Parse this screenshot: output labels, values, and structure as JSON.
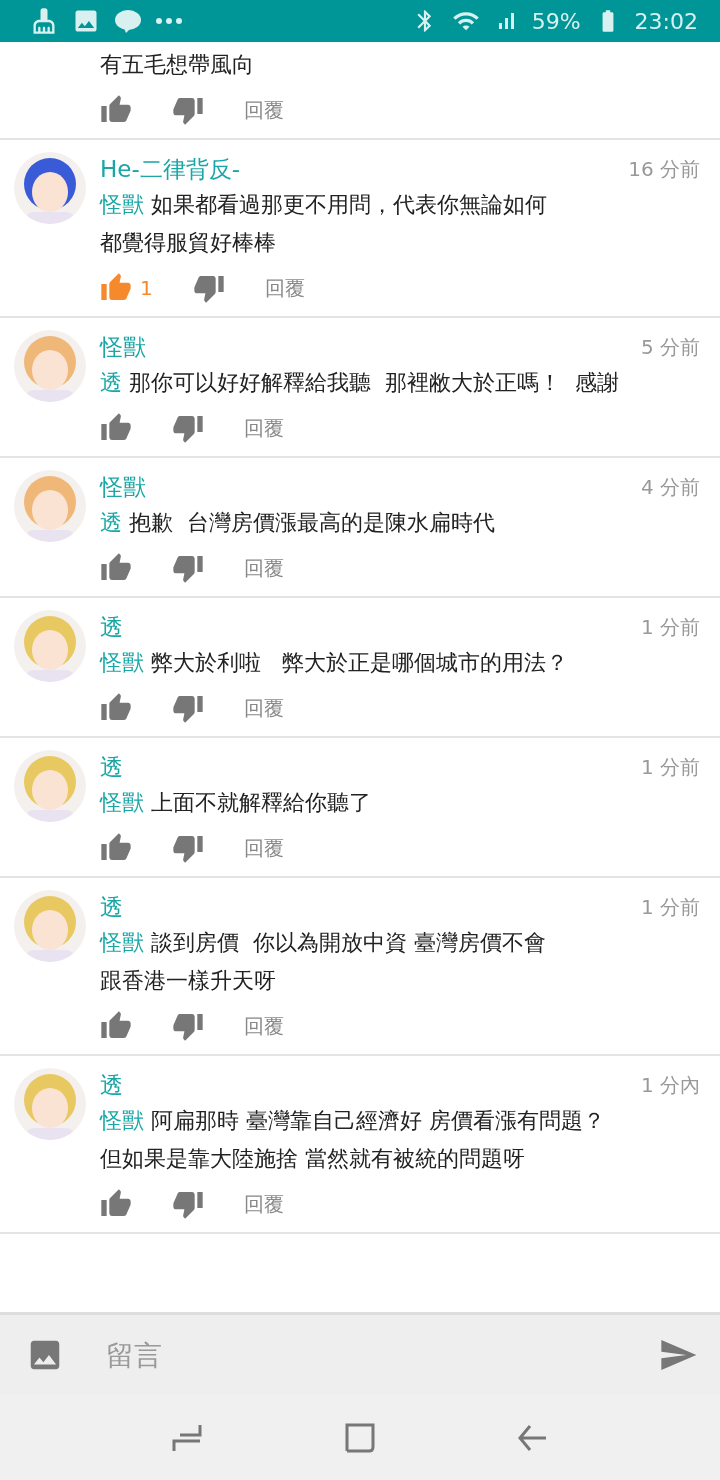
{
  "status_bar": {
    "battery": "59%",
    "time": "23:02"
  },
  "comments": [
    {
      "lines": [
        "有五毛想帶風向"
      ],
      "liked": false,
      "reply": "回覆"
    },
    {
      "name": "He-二律背反-",
      "time": "16 分前",
      "color": "#3a5bd8",
      "reply_to": "怪獸",
      "lines": [
        "如果都看過那更不用問，代表你無論如何",
        "都覺得服貿好棒棒"
      ],
      "liked": true,
      "likes": "1",
      "reply": "回覆"
    },
    {
      "name": "怪獸",
      "time": "5 分前",
      "color": "#f0b878",
      "reply_to": "透",
      "lines": [
        "那你可以好好解釋給我聽  那裡敝大於正嗎！  感謝"
      ],
      "liked": false,
      "reply": "回覆"
    },
    {
      "name": "怪獸",
      "time": "4 分前",
      "color": "#f0b878",
      "reply_to": "透",
      "lines": [
        "抱歉  台灣房價漲最高的是陳水扁時代"
      ],
      "liked": false,
      "reply": "回覆"
    },
    {
      "name": "透",
      "time": "1 分前",
      "color": "#e8c860",
      "reply_to": "怪獸",
      "lines": [
        "弊大於利啦   弊大於正是哪個城市的用法？"
      ],
      "liked": false,
      "reply": "回覆"
    },
    {
      "name": "透",
      "time": "1 分前",
      "color": "#e8c860",
      "reply_to": "怪獸",
      "lines": [
        "上面不就解釋給你聽了"
      ],
      "liked": false,
      "reply": "回覆"
    },
    {
      "name": "透",
      "time": "1 分前",
      "color": "#e8c860",
      "reply_to": "怪獸",
      "lines": [
        "談到房價  你以為開放中資 臺灣房價不會",
        "跟香港一樣升天呀"
      ],
      "liked": false,
      "reply": "回覆"
    },
    {
      "name": "透",
      "time": "1 分內",
      "color": "#e8c860",
      "reply_to": "怪獸",
      "lines": [
        "阿扁那時 臺灣靠自己經濟好 房價看漲有問題？",
        "但如果是靠大陸施捨 當然就有被統的問題呀"
      ],
      "liked": false,
      "reply": "回覆"
    }
  ],
  "composer": {
    "placeholder": "留言"
  }
}
